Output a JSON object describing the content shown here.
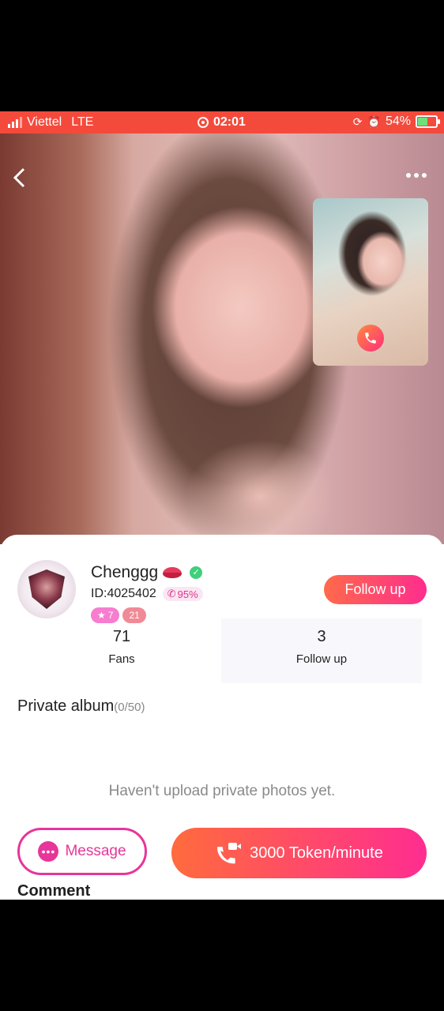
{
  "status_bar": {
    "carrier": "Viettel",
    "network": "LTE",
    "time": "02:01",
    "battery": "54%"
  },
  "profile": {
    "name": "Chenggg",
    "id": "ID:4025402",
    "call_rate": "95%",
    "level_badge": "7",
    "age_badge": "21",
    "follow_button": "Follow up"
  },
  "stats": {
    "fans_count": "71",
    "fans_label": "Fans",
    "follow_count": "3",
    "follow_label": "Follow up"
  },
  "album": {
    "title": "Private album",
    "count": "(0/50)",
    "empty_text": "Haven't upload private photos yet."
  },
  "actions": {
    "message_label": "Message",
    "call_label": "3000 Token/minute"
  },
  "comment_title": "Comment",
  "colors": {
    "status_bar": "#f44a3c",
    "accent_pink": "#e8359a",
    "accent_orange": "#ff6b3d"
  }
}
